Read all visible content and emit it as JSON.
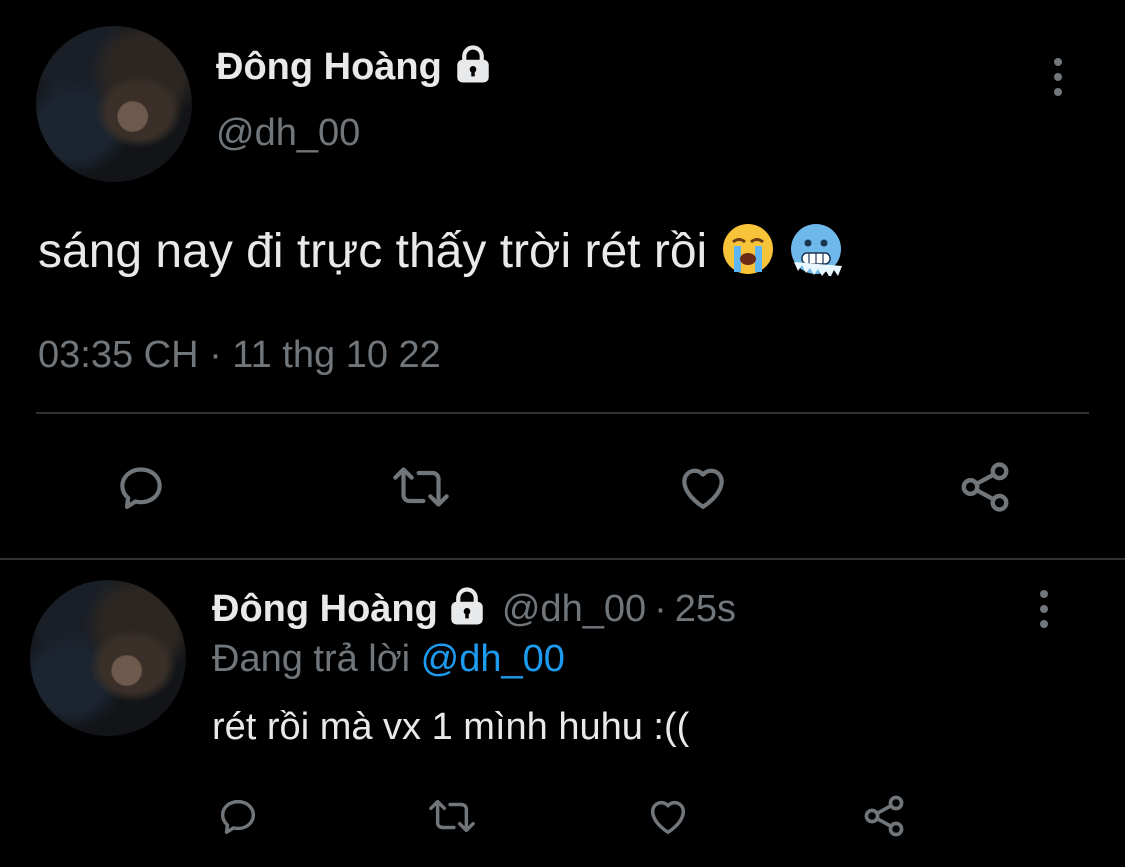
{
  "tweet": {
    "author_name": "Đông Hoàng",
    "handle": "@dh_00",
    "text": "sáng nay đi trực thấy trời rét rồi",
    "emojis": [
      "loudly-crying-face",
      "cold-face"
    ],
    "timestamp": "03:35 CH · 11 thg 10 22"
  },
  "reply": {
    "author_name": "Đông Hoàng",
    "handle": "@dh_00",
    "separator": "·",
    "time_ago": "25s",
    "replying_prefix": "Đang trả lời",
    "replying_to": "@dh_00",
    "text": "rét rồi mà vx 1 mình huhu :(("
  },
  "actions": [
    "reply-icon",
    "retweet-icon",
    "like-icon",
    "share-icon"
  ],
  "colors": {
    "background": "#000000",
    "text": "#E7E9EA",
    "muted": "#71767B",
    "link": "#1D9BF0",
    "divider": "#2F3336"
  }
}
